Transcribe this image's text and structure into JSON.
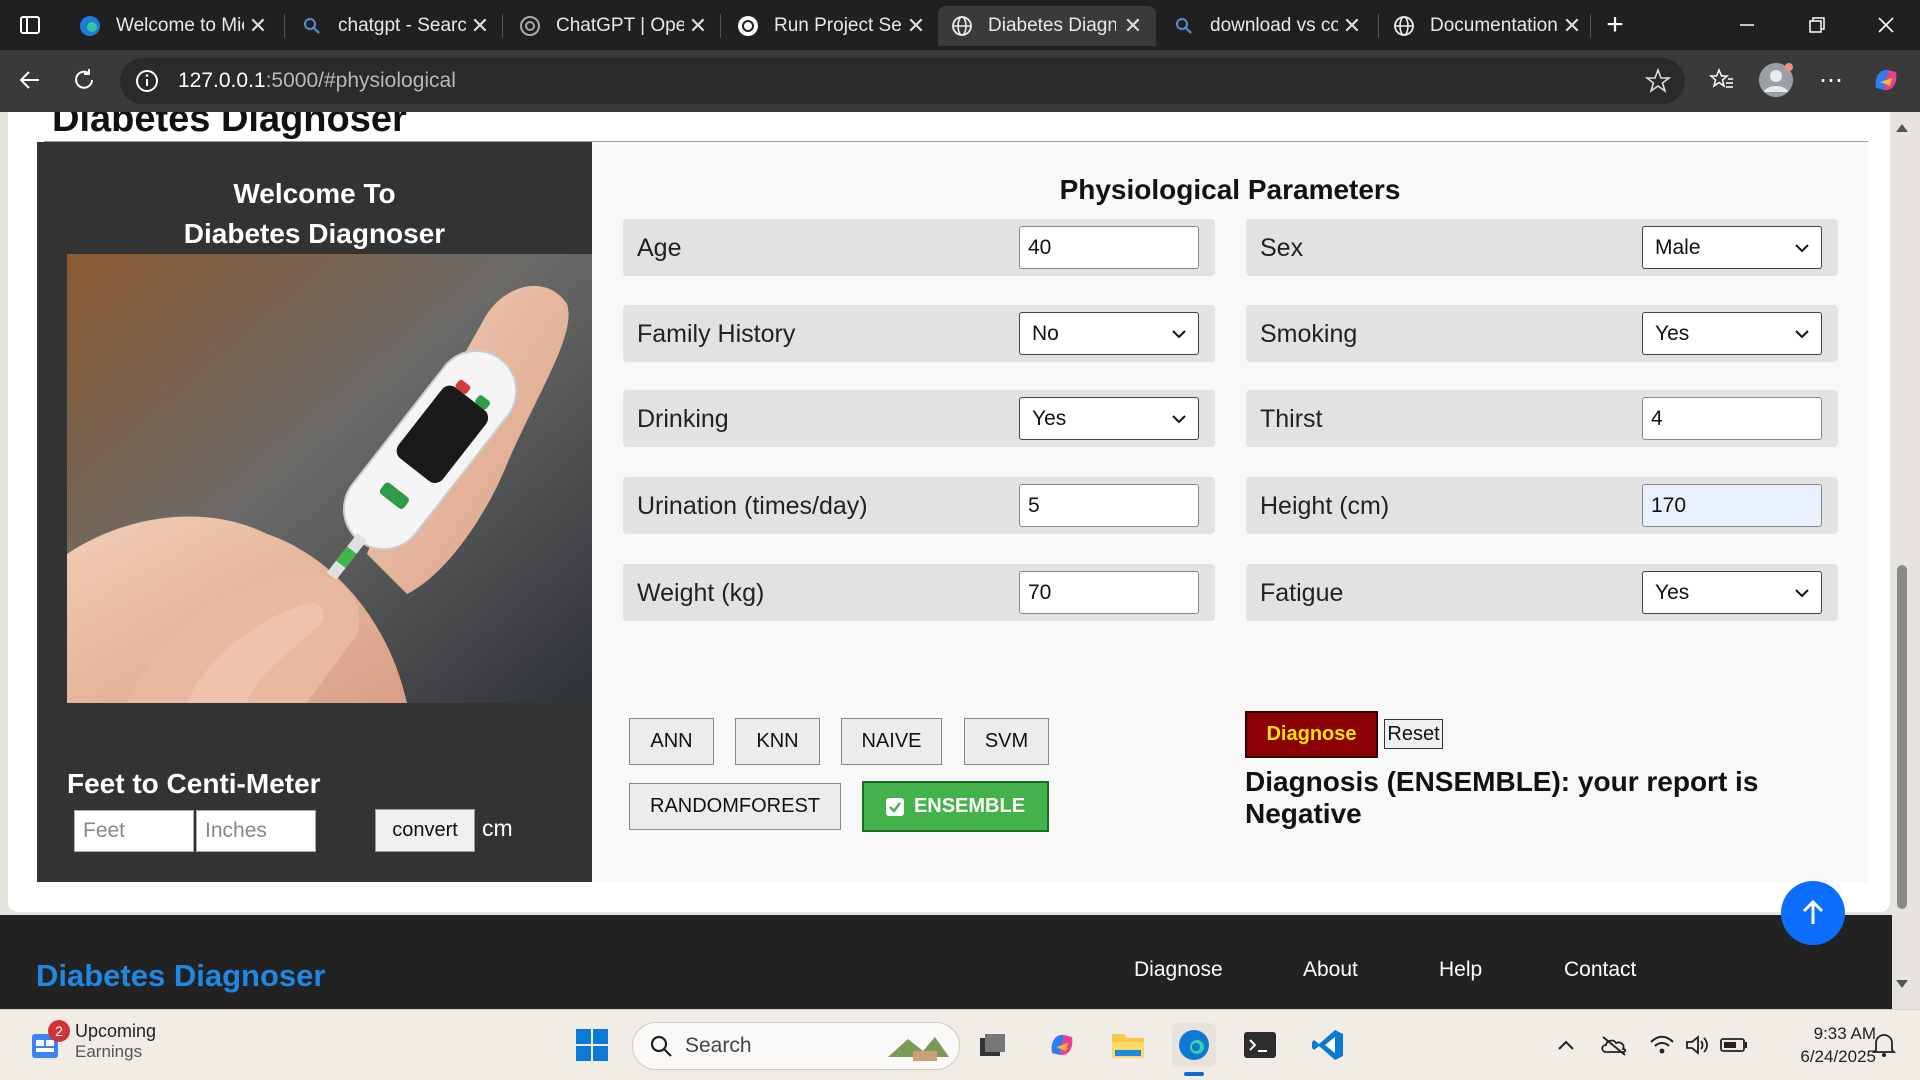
{
  "browser": {
    "tabs": [
      {
        "title": "Welcome to Microsoft Edge",
        "icon": "edge-icon",
        "active": false
      },
      {
        "title": "chatgpt - Search",
        "icon": "search-icon",
        "active": false
      },
      {
        "title": "ChatGPT | OpenAI",
        "icon": "openai-icon",
        "active": false
      },
      {
        "title": "Run Project Setup",
        "icon": "openai-icon",
        "active": false
      },
      {
        "title": "Diabetes Diagnoser",
        "icon": "globe-icon",
        "active": true
      },
      {
        "title": "download vs code",
        "icon": "search-icon",
        "active": false
      },
      {
        "title": "Documentation",
        "icon": "globe-icon",
        "active": false
      }
    ],
    "url_host": "127.0.0.1",
    "url_rest": ":5000/#physiological"
  },
  "page": {
    "heading": "Diabetes Diagnoser",
    "welcome_line1": "Welcome To",
    "welcome_line2": "Diabetes Diagnoser",
    "hero_image": "glucose-meter-photo",
    "converter": {
      "title": "Feet to Centi-Meter",
      "feet_placeholder": "Feet",
      "inches_placeholder": "Inches",
      "convert_label": "convert",
      "unit": "cm"
    },
    "section_title": "Physiological Parameters",
    "params": [
      {
        "label": "Age",
        "type": "input",
        "value": "40"
      },
      {
        "label": "Sex",
        "type": "select",
        "value": "Male"
      },
      {
        "label": "Family History",
        "type": "select",
        "value": "No"
      },
      {
        "label": "Smoking",
        "type": "select",
        "value": "Yes"
      },
      {
        "label": "Drinking",
        "type": "select",
        "value": "Yes"
      },
      {
        "label": "Thirst",
        "type": "input",
        "value": "4"
      },
      {
        "label": "Urination (times/day)",
        "type": "input",
        "value": "5"
      },
      {
        "label": "Height (cm)",
        "type": "input",
        "value": "170"
      },
      {
        "label": "Weight (kg)",
        "type": "input",
        "value": "70"
      },
      {
        "label": "Fatigue",
        "type": "select",
        "value": "Yes"
      }
    ],
    "models": [
      "ANN",
      "KNN",
      "NAIVE",
      "SVM",
      "RANDOMFOREST",
      "ENSEMBLE"
    ],
    "selected_model": "ENSEMBLE",
    "diagnose_label": "Diagnose",
    "reset_label": "Reset",
    "result_text": "Diagnosis (ENSEMBLE): your report is Negative"
  },
  "footer": {
    "brand": "Diabetes Diagnoser",
    "links": [
      "Diagnose",
      "About",
      "Help",
      "Contact"
    ]
  },
  "taskbar": {
    "widget_badge": "2",
    "widget_title": "Upcoming",
    "widget_subtitle": "Earnings",
    "search_placeholder": "Search",
    "time": "9:33 AM",
    "date": "6/24/2025"
  },
  "colors": {
    "accent_blue": "#1e88e5",
    "ensemble_green": "#43b24a",
    "diagnose_red": "#8b0000",
    "diagnose_text": "#ffe600"
  }
}
